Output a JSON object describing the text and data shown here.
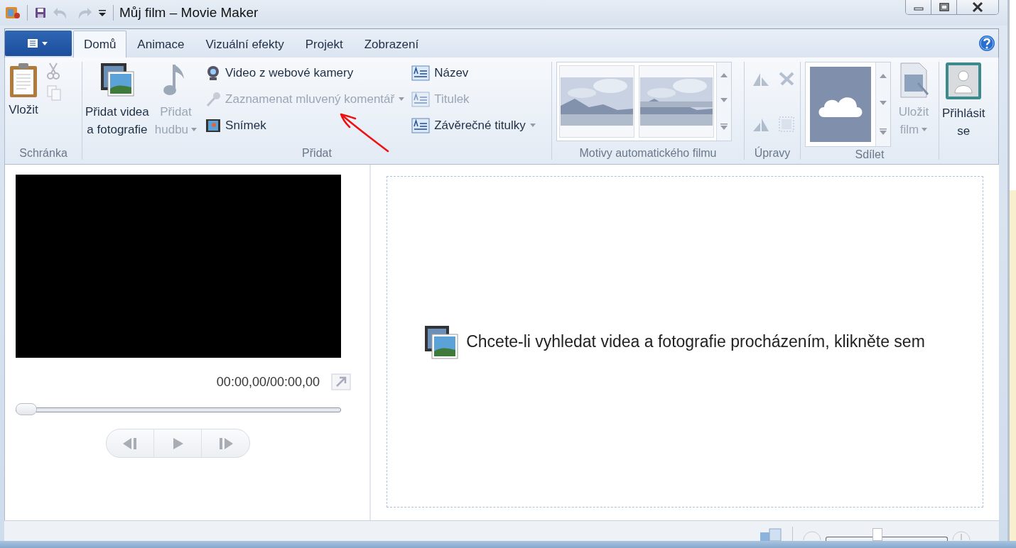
{
  "window": {
    "title": "Můj film – Movie Maker"
  },
  "tabs": [
    {
      "label": "Domů",
      "selected": true
    },
    {
      "label": "Animace",
      "selected": false
    },
    {
      "label": "Vizuální efekty",
      "selected": false
    },
    {
      "label": "Projekt",
      "selected": false
    },
    {
      "label": "Zobrazení",
      "selected": false
    }
  ],
  "clipboard": {
    "label": "Schránka",
    "paste": {
      "label": "Vložit"
    },
    "cut": {
      "disabled": true
    },
    "copy": {
      "disabled": true
    }
  },
  "add": {
    "label": "Přidat",
    "large": [
      {
        "kind": "video",
        "lines": [
          "Přidat videa",
          "a fotografie"
        ],
        "disabled": false,
        "dropdown": false
      },
      {
        "kind": "music",
        "lines": [
          "Přidat",
          "hudbu"
        ],
        "disabled": true,
        "dropdown": true
      }
    ],
    "small": [
      {
        "kind": "webcam",
        "label": "Video z webové kamery",
        "disabled": false,
        "dropdown": false
      },
      {
        "kind": "mic",
        "label": "Zaznamenat mluvený komentář",
        "disabled": true,
        "dropdown": true
      },
      {
        "kind": "snapshot",
        "label": "Snímek",
        "disabled": false,
        "dropdown": false
      },
      {
        "kind": "title",
        "label": "Název",
        "disabled": false,
        "dropdown": false
      },
      {
        "kind": "caption",
        "label": "Titulek",
        "disabled": true,
        "dropdown": false
      },
      {
        "kind": "credits",
        "label": "Závěrečné titulky",
        "disabled": false,
        "dropdown": true
      }
    ]
  },
  "themes": {
    "label": "Motivy automatického filmu"
  },
  "edit": {
    "label": "Úpravy",
    "tools": [
      {
        "kind": "rotate-left",
        "disabled": true
      },
      {
        "kind": "remove",
        "disabled": true
      },
      {
        "kind": "rotate-right",
        "disabled": true
      },
      {
        "kind": "select-all",
        "disabled": true
      }
    ]
  },
  "share": {
    "label": "Sdílet",
    "save": {
      "lines": [
        "Uložit",
        "film"
      ],
      "disabled": true,
      "dropdown": true
    }
  },
  "signin": {
    "lines": [
      "Přihlásit",
      "se"
    ]
  },
  "preview": {
    "time": "00:00,00/00:00,00",
    "seek": {
      "level": 0
    }
  },
  "zoom": {
    "level": 0.42
  },
  "storyboard": {
    "hint": "Chcete-li vyhledat videa a fotografie procházením, klikněte sem"
  }
}
